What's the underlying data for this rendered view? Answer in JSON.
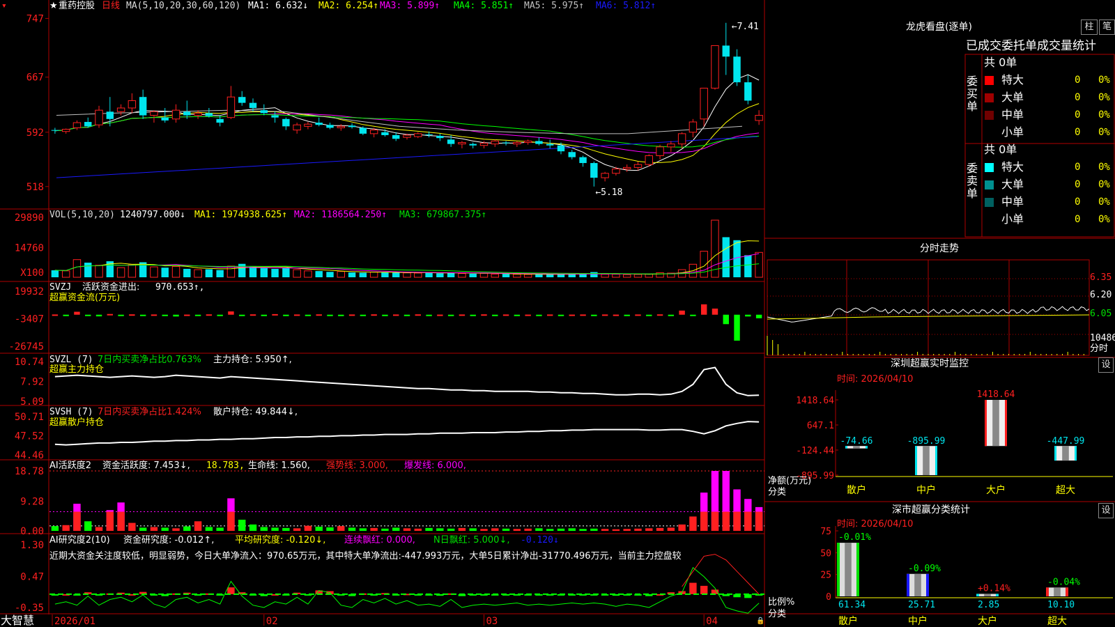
{
  "colors": {
    "up": "#ff2020",
    "down": "#00e5ee",
    "grid": "#b00000",
    "bg": "#000000",
    "text": "#dddddd",
    "yellow": "#ffff00",
    "magenta": "#ff00ff",
    "green": "#00ff00",
    "blue": "#1a1aff"
  },
  "stock": {
    "name": "重药控股",
    "period": "日线"
  },
  "price_panel": {
    "ma_params": "MA(5,10,20,30,60,120)",
    "mas": [
      {
        "label": "MA1: 6.632↓",
        "color": "#ffffff"
      },
      {
        "label": "MA2: 6.254↑",
        "color": "#ffff00"
      },
      {
        "label": "MA3: 5.899↑",
        "color": "#ff00ff"
      },
      {
        "label": "MA4: 5.851↑",
        "color": "#00ff00"
      },
      {
        "label": "MA5: 5.975↑",
        "color": "#c0c0c0"
      },
      {
        "label": "MA6: 5.812↑",
        "color": "#1a1aff"
      }
    ],
    "y_ticks": [
      "747",
      "667",
      "592",
      "518"
    ],
    "ymin": 4.95,
    "ymax": 7.55,
    "high_label": "7.41",
    "low_label": "5.18"
  },
  "vol_panel": {
    "header": "VOL(5,10,20)",
    "value": "1240797.000↓",
    "ma1": "MA1: 1974938.625↑",
    "ma2": "MA2: 1186564.250↑",
    "ma3": "MA3: 679867.375↑",
    "y_ticks": [
      "29890",
      "14760"
    ],
    "unit": "X100"
  },
  "svzj_panel": {
    "header": "SVZJ",
    "line1_label": "活跃资金进出:",
    "line1_value": "970.653↑,",
    "line2": "超赢资金流(万元)",
    "y_ticks": [
      "19932",
      "-3407",
      "-26745"
    ]
  },
  "svzl_panel": {
    "header": "SVZL (7)",
    "desc": "7日内买卖净占比0.763%",
    "hold": "主力持仓: 5.950↑,",
    "line2": "超赢主力持仓",
    "y_ticks": [
      "10.74",
      "7.92",
      "5.09"
    ]
  },
  "svsh_panel": {
    "header": "SVSH (7)",
    "desc": "7日内买卖净占比1.424%",
    "hold": "散户持仓: 49.844↓,",
    "line2": "超赢散户持仓",
    "y_ticks": [
      "50.71",
      "47.52",
      "44.46"
    ]
  },
  "ai1_panel": {
    "header": "AI活跃度2",
    "a": "资金活跃度: 7.453↓,",
    "b": "18.783,",
    "c": "生命线: 1.560,",
    "d": "强势线: 3.000,",
    "e": "爆发线: 6.000,",
    "y_ticks": [
      "18.78",
      "9.28",
      "0.00"
    ]
  },
  "ai2_panel": {
    "header": "AI研究度2(10)",
    "a": "资金研究度: -0.012↑,",
    "b": "平均研究度: -0.120↓,",
    "c": "连续飘红: 0.000,",
    "d": "N日飘红: 5.000↓,",
    "e": "-0.120↓",
    "comment": "近期大资金关注度较低，明显弱势，今日大单净流入：970.65万元，其中特大单净流出:-447.993万元，大单5日累计净出-31770.496万元，当前主力控盘较",
    "y_ticks": [
      "1.30",
      "0.47",
      "-0.35"
    ]
  },
  "x_axis": {
    "labels": [
      "2026/01",
      "02",
      "03",
      "04"
    ]
  },
  "brand": "大智慧",
  "tabs": {
    "zhu": "柱",
    "bi": "笔"
  },
  "lhb": {
    "title": "龙虎看盘(逐单)",
    "subtitle": "已成交委托单成交量统计",
    "buy": {
      "side": "委买单",
      "count": "共 0单",
      "rows": [
        {
          "label": "特大",
          "v": "0",
          "p": "0%",
          "c": "#ff0000"
        },
        {
          "label": "大单",
          "v": "0",
          "p": "0%",
          "c": "#a00000"
        },
        {
          "label": "中单",
          "v": "0",
          "p": "0%",
          "c": "#700000"
        },
        {
          "label": "小单",
          "v": "0",
          "p": "0%",
          "c": ""
        }
      ]
    },
    "sell": {
      "side": "委卖单",
      "count": "共 0单",
      "rows": [
        {
          "label": "特大",
          "v": "0",
          "p": "0%",
          "c": "#00ffff"
        },
        {
          "label": "大单",
          "v": "0",
          "p": "0%",
          "c": "#009090"
        },
        {
          "label": "中单",
          "v": "0",
          "p": "0%",
          "c": "#006060"
        },
        {
          "label": "小单",
          "v": "0",
          "p": "0%",
          "c": ""
        }
      ]
    }
  },
  "intraday": {
    "title": "分时走势",
    "prices": [
      "6.35",
      "6.20",
      "6.05"
    ],
    "vol": "10486",
    "label": "分时"
  },
  "sz_monitor": {
    "title": "深圳超赢实时监控",
    "time": "时间: 2026/04/10",
    "settings": "设",
    "y_ticks": [
      "1418.64",
      "647.1",
      "-124.44",
      "-895.99"
    ],
    "axis_title": "净额(万元)",
    "cat_title": "分类",
    "bars": [
      {
        "cat": "散户",
        "value": -74.66,
        "label": "-74.66"
      },
      {
        "cat": "中户",
        "value": -895.99,
        "label": "-895.99"
      },
      {
        "cat": "大户",
        "value": 1418.64,
        "label": "1418.64"
      },
      {
        "cat": "超大",
        "value": -447.99,
        "label": "-447.99"
      }
    ]
  },
  "sz_class": {
    "title": "深市超赢分类统计",
    "time": "时间: 2026/04/10",
    "settings": "设",
    "y_ticks": [
      "75",
      "50",
      "25",
      "0"
    ],
    "axis_title": "比例%",
    "cat_title": "分类",
    "bars": [
      {
        "cat": "散户",
        "value": 61.34,
        "label": "61.34",
        "change": "-0.01%",
        "color": "#00e000"
      },
      {
        "cat": "中户",
        "value": 25.71,
        "label": "25.71",
        "change": "-0.09%",
        "color": "#1a1aff"
      },
      {
        "cat": "大户",
        "value": 2.85,
        "label": "2.85",
        "change": "+0.14%",
        "color": "#00e5ee"
      },
      {
        "cat": "超大",
        "value": 10.1,
        "label": "10.10",
        "change": "-0.04%",
        "color": "#ff2020"
      }
    ]
  },
  "chart_data": [
    {
      "type": "candlestick",
      "title": "重药控股 日线",
      "x": [
        "2026/01",
        "02",
        "03",
        "04"
      ],
      "ylim": [
        5.18,
        7.41
      ],
      "ohlc": [
        [
          5.95,
          5.98,
          5.9,
          5.94
        ],
        [
          5.93,
          5.97,
          5.9,
          5.96
        ],
        [
          5.98,
          6.08,
          5.95,
          6.05
        ],
        [
          6.06,
          6.12,
          5.98,
          6.0
        ],
        [
          6.02,
          6.28,
          5.98,
          6.22
        ],
        [
          6.2,
          6.4,
          6.0,
          6.1
        ],
        [
          6.2,
          6.3,
          6.15,
          6.25
        ],
        [
          6.25,
          6.45,
          6.18,
          6.35
        ],
        [
          6.4,
          6.5,
          6.1,
          6.15
        ],
        [
          6.15,
          6.22,
          6.05,
          6.2
        ],
        [
          6.12,
          6.25,
          6.05,
          6.08
        ],
        [
          6.1,
          6.3,
          6.05,
          6.22
        ],
        [
          6.2,
          6.35,
          6.1,
          6.15
        ],
        [
          6.15,
          6.22,
          6.1,
          6.18
        ],
        [
          6.18,
          6.25,
          6.12,
          6.14
        ],
        [
          6.1,
          6.15,
          6.0,
          6.05
        ],
        [
          6.12,
          6.55,
          6.1,
          6.4
        ],
        [
          6.4,
          6.48,
          6.28,
          6.32
        ],
        [
          6.32,
          6.38,
          6.2,
          6.25
        ],
        [
          6.22,
          6.3,
          6.15,
          6.18
        ],
        [
          6.15,
          6.2,
          6.05,
          6.12
        ],
        [
          6.1,
          6.12,
          5.95,
          6.0
        ],
        [
          5.95,
          6.05,
          5.9,
          6.02
        ],
        [
          6.0,
          6.06,
          5.96,
          6.03
        ],
        [
          6.05,
          6.12,
          6.0,
          6.02
        ],
        [
          6.02,
          6.05,
          5.96,
          5.98
        ],
        [
          5.98,
          6.03,
          5.94,
          6.0
        ],
        [
          6.01,
          6.04,
          5.97,
          5.99
        ],
        [
          5.98,
          6.0,
          5.88,
          5.9
        ],
        [
          5.9,
          5.98,
          5.85,
          5.95
        ],
        [
          5.92,
          5.96,
          5.86,
          5.88
        ],
        [
          5.88,
          5.92,
          5.8,
          5.83
        ],
        [
          5.85,
          5.9,
          5.82,
          5.88
        ],
        [
          5.86,
          5.92,
          5.84,
          5.9
        ],
        [
          5.89,
          5.93,
          5.85,
          5.88
        ],
        [
          5.87,
          5.9,
          5.8,
          5.84
        ],
        [
          5.82,
          5.88,
          5.72,
          5.76
        ],
        [
          5.76,
          5.8,
          5.7,
          5.78
        ],
        [
          5.76,
          5.78,
          5.7,
          5.74
        ],
        [
          5.74,
          5.8,
          5.7,
          5.77
        ],
        [
          5.76,
          5.82,
          5.72,
          5.8
        ],
        [
          5.78,
          5.8,
          5.74,
          5.77
        ],
        [
          5.76,
          5.8,
          5.72,
          5.78
        ],
        [
          5.78,
          5.82,
          5.75,
          5.8
        ],
        [
          5.8,
          5.85,
          5.74,
          5.76
        ],
        [
          5.76,
          5.82,
          5.7,
          5.74
        ],
        [
          5.74,
          5.78,
          5.62,
          5.66
        ],
        [
          5.65,
          5.68,
          5.55,
          5.58
        ],
        [
          5.58,
          5.6,
          5.45,
          5.5
        ],
        [
          5.5,
          5.52,
          5.18,
          5.3
        ],
        [
          5.3,
          5.38,
          5.25,
          5.36
        ],
        [
          5.36,
          5.45,
          5.33,
          5.42
        ],
        [
          5.42,
          5.48,
          5.38,
          5.44
        ],
        [
          5.44,
          5.52,
          5.4,
          5.48
        ],
        [
          5.48,
          5.62,
          5.45,
          5.6
        ],
        [
          5.6,
          5.75,
          5.55,
          5.72
        ],
        [
          5.72,
          5.8,
          5.65,
          5.76
        ],
        [
          5.76,
          5.92,
          5.7,
          5.9
        ],
        [
          5.92,
          6.1,
          5.85,
          6.06
        ],
        [
          6.1,
          6.52,
          6.0,
          6.52
        ],
        [
          6.52,
          7.1,
          6.5,
          7.1
        ],
        [
          7.1,
          7.41,
          6.7,
          6.95
        ],
        [
          6.95,
          7.05,
          6.55,
          6.6
        ],
        [
          6.6,
          6.7,
          6.3,
          6.35
        ],
        [
          6.08,
          6.22,
          6.02,
          6.15
        ]
      ],
      "series": [
        {
          "name": "MA1",
          "values": [
            6.632
          ]
        },
        {
          "name": "MA2",
          "values": [
            6.254
          ]
        },
        {
          "name": "MA3",
          "values": [
            5.899
          ]
        },
        {
          "name": "MA4",
          "values": [
            5.851
          ]
        },
        {
          "name": "MA5",
          "values": [
            5.975
          ]
        },
        {
          "name": "MA6",
          "values": [
            5.812
          ]
        }
      ]
    },
    {
      "type": "bar",
      "title": "VOL(5,10,20)",
      "ylabel": "X100",
      "ylim": [
        0,
        29890
      ],
      "values": [
        3500,
        3200,
        8800,
        7300,
        6000,
        8000,
        4800,
        6200,
        7500,
        5200,
        4800,
        5400,
        4200,
        3800,
        4000,
        3600,
        5600,
        6700,
        5300,
        4600,
        4200,
        4700,
        3800,
        3200,
        3100,
        2700,
        2900,
        2400,
        2300,
        2600,
        2500,
        2300,
        2200,
        2100,
        2300,
        2000,
        2400,
        1900,
        1800,
        2000,
        1600,
        1700,
        1500,
        1400,
        1500,
        1400,
        1600,
        1800,
        1700,
        2600,
        1500,
        1500,
        1300,
        1400,
        1700,
        2300,
        2100,
        3800,
        6500,
        13000,
        28500,
        20000,
        18500,
        11000,
        12407
      ]
    },
    {
      "type": "bar",
      "title": "SVZJ 超赢资金流(万元)",
      "ylim": [
        -26745,
        19932
      ],
      "values": [
        200,
        -400,
        2500,
        -800,
        -1400,
        600,
        -500,
        300,
        -300,
        200,
        -600,
        -1500,
        100,
        -200,
        300,
        -400,
        2800,
        -200,
        300,
        -400,
        500,
        -300,
        200,
        -100,
        300,
        -300,
        -1200,
        200,
        -100,
        300,
        -200,
        200,
        -100,
        300,
        -200,
        100,
        -100,
        200,
        -100,
        300,
        -100,
        200,
        -200,
        100,
        -100,
        200,
        -300,
        100,
        200,
        -300,
        200,
        100,
        -100,
        200,
        -100,
        300,
        -200,
        3500,
        -300,
        8800,
        5200,
        -8000,
        -22000,
        -1500,
        -3000,
        970.653
      ]
    },
    {
      "type": "line",
      "title": "SVZL 超赢主力持仓",
      "ylim": [
        5.09,
        10.74
      ],
      "series": [
        {
          "name": "主力持仓",
          "values": [
            8.6,
            8.7,
            8.8,
            8.7,
            8.6,
            8.5,
            8.6,
            8.7,
            8.6,
            8.5,
            8.6,
            8.8,
            8.7,
            8.6,
            8.5,
            8.4,
            8.6,
            8.5,
            8.4,
            8.3,
            8.2,
            8.1,
            8.0,
            7.9,
            7.8,
            7.7,
            7.6,
            7.5,
            7.4,
            7.3,
            7.2,
            7.1,
            7.0,
            6.9,
            6.9,
            6.8,
            6.7,
            6.7,
            6.6,
            6.6,
            6.5,
            6.5,
            6.5,
            6.5,
            6.4,
            6.4,
            6.3,
            6.3,
            6.2,
            6.2,
            6.1,
            6.0,
            6.0,
            6.1,
            6.1,
            6.0,
            6.1,
            6.5,
            7.5,
            9.6,
            9.9,
            7.5,
            6.3,
            5.9,
            5.95
          ]
        }
      ]
    },
    {
      "type": "line",
      "title": "SVSH 超赢散户持仓",
      "ylim": [
        44.46,
        50.71
      ],
      "series": [
        {
          "name": "散户持仓",
          "values": [
            46.2,
            46.1,
            46.2,
            46.3,
            46.4,
            46.4,
            46.5,
            46.5,
            46.6,
            46.7,
            46.7,
            46.8,
            46.8,
            46.9,
            46.9,
            47.0,
            47.0,
            47.1,
            47.1,
            47.2,
            47.3,
            47.3,
            47.4,
            47.4,
            47.5,
            47.5,
            47.6,
            47.6,
            47.7,
            47.7,
            47.8,
            47.8,
            47.8,
            47.9,
            47.9,
            48.0,
            48.0,
            48.0,
            48.1,
            48.1,
            48.1,
            48.2,
            48.2,
            48.3,
            48.3,
            48.4,
            48.4,
            48.5,
            48.5,
            48.6,
            48.6,
            48.6,
            48.6,
            48.6,
            48.5,
            48.5,
            48.6,
            48.6,
            48.3,
            47.9,
            48.4,
            49.2,
            49.6,
            49.9,
            49.844
          ]
        }
      ]
    },
    {
      "type": "bar",
      "title": "AI活跃度2 资金活跃度",
      "ylim": [
        0,
        18.78
      ],
      "values": [
        1.5,
        1.8,
        8.5,
        3.0,
        1.2,
        6.5,
        8.9,
        2.5,
        1.0,
        1.2,
        1.0,
        0.8,
        1.4,
        3.0,
        1.2,
        1.0,
        10.2,
        3.5,
        2.0,
        1.2,
        1.0,
        0.9,
        0.8,
        1.6,
        1.3,
        1.1,
        1.5,
        1.0,
        0.8,
        0.9,
        0.7,
        1.0,
        0.8,
        0.7,
        0.9,
        0.8,
        0.7,
        0.9,
        0.8,
        0.6,
        0.8,
        0.7,
        0.6,
        0.7,
        0.8,
        0.6,
        0.7,
        0.8,
        0.6,
        0.7,
        0.6,
        0.5,
        0.6,
        0.7,
        0.8,
        0.9,
        1.0,
        2.0,
        4.5,
        12.0,
        18.78,
        18.78,
        13.0,
        10.0,
        7.453
      ],
      "lines": {
        "生命线": 1.56,
        "强势线": 3.0,
        "爆发线": 6.0
      }
    },
    {
      "type": "bar",
      "title": "AI研究度2(10) 资金研究度",
      "ylim": [
        -0.35,
        1.3
      ],
      "values": [
        -0.02,
        0.0,
        -0.03,
        0.05,
        -0.03,
        0.02,
        0.04,
        0.0,
        0.06,
        -0.02,
        -0.05,
        0.02,
        0.04,
        -0.01,
        0.02,
        -0.02,
        0.18,
        0.05,
        -0.03,
        -0.05,
        0.0,
        -0.02,
        0.04,
        -0.02,
        0.1,
        0.08,
        -0.03,
        -0.05,
        0.02,
        -0.01,
        0.03,
        -0.02,
        0.01,
        -0.03,
        -0.02,
        -0.04,
        0.02,
        -0.05,
        -0.03,
        -0.02,
        -0.03,
        -0.02,
        -0.01,
        -0.03,
        -0.02,
        -0.03,
        -0.02,
        -0.01,
        -0.02,
        -0.01,
        -0.02,
        -0.04,
        -0.02,
        -0.03,
        -0.05,
        0.0,
        0.05,
        0.08,
        0.3,
        0.22,
        0.12,
        -0.05,
        -0.08,
        -0.1,
        -0.012
      ],
      "series": [
        {
          "name": "平均研究度",
          "values": [
            -0.12
          ]
        }
      ]
    },
    {
      "type": "bar",
      "title": "深圳超赢实时监控",
      "xlabel": "分类",
      "ylabel": "净额(万元)",
      "categories": [
        "散户",
        "中户",
        "大户",
        "超大"
      ],
      "values": [
        -74.66,
        -895.99,
        1418.64,
        -447.99
      ]
    },
    {
      "type": "bar",
      "title": "深市超赢分类统计",
      "xlabel": "分类",
      "ylabel": "比例%",
      "categories": [
        "散户",
        "中户",
        "大户",
        "超大"
      ],
      "values": [
        61.34,
        25.71,
        2.85,
        10.1
      ],
      "ylim": [
        0,
        75
      ]
    }
  ]
}
